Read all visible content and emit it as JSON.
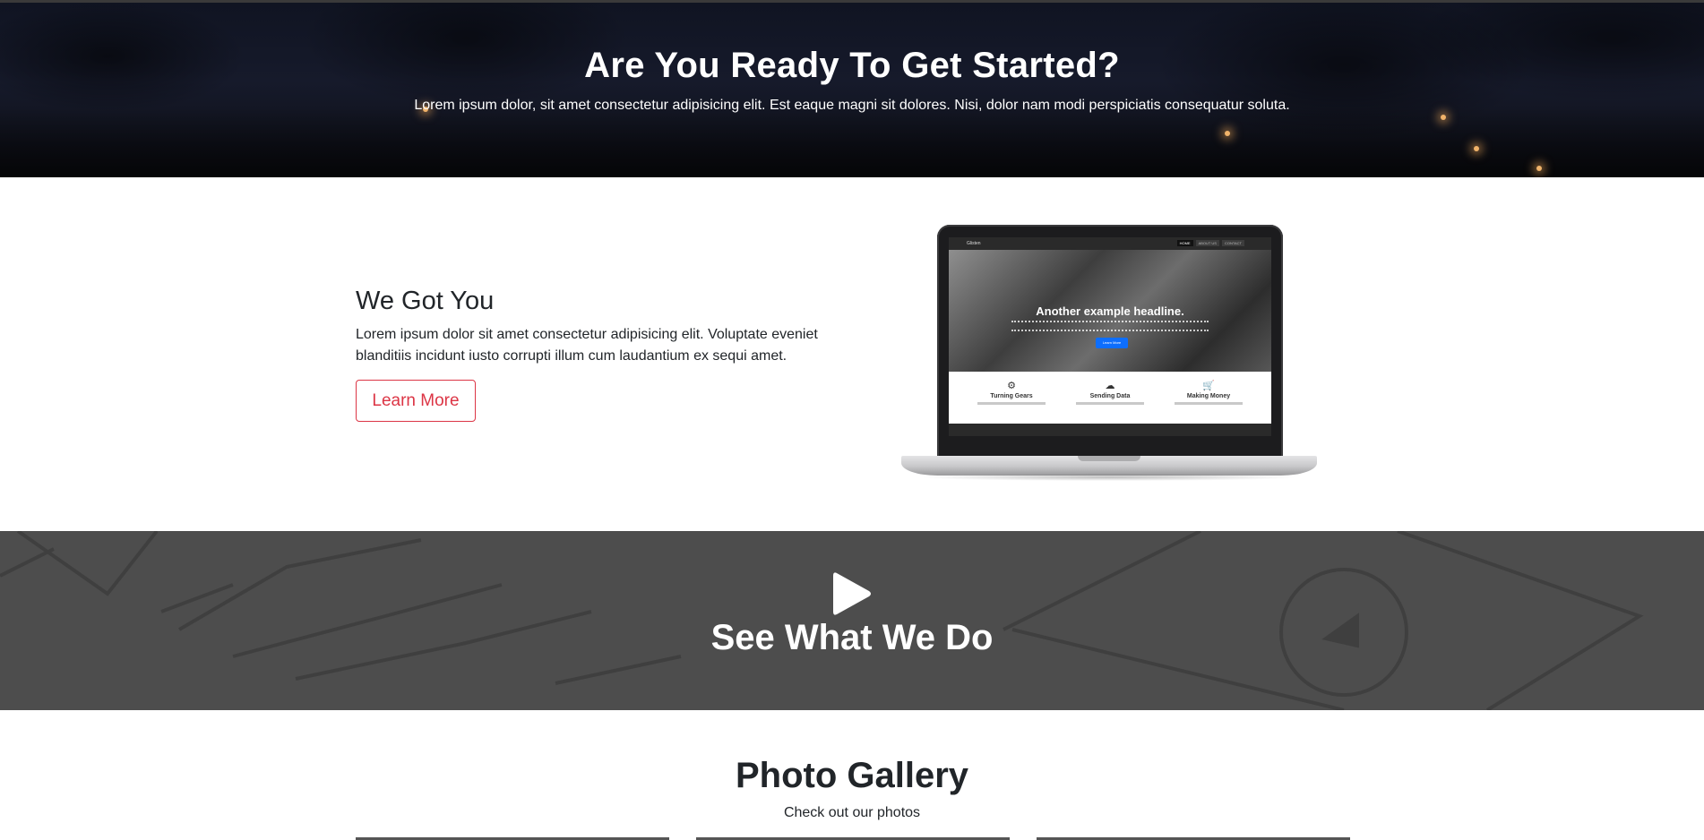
{
  "hero": {
    "title": "Are You Ready To Get Started?",
    "subtitle": "Lorem ipsum dolor, sit amet consectetur adipisicing elit. Est eaque magni sit dolores. Nisi, dolor nam modi perspiciatis consequatur soluta."
  },
  "about": {
    "title": "We Got You",
    "description": "Lorem ipsum dolor sit amet consectetur adipisicing elit. Voluptate eveniet blanditiis incidunt iusto corrupti illum cum laudantium ex sequi amet.",
    "button_label": "Learn More",
    "laptop_screen": {
      "brand": "Glisten",
      "nav": [
        "HOME",
        "ABOUT US",
        "CONTACT"
      ],
      "headline": "Another example headline.",
      "button_label": "Learn More",
      "features": [
        {
          "icon": "gear-icon",
          "glyph": "⚙",
          "name": "Turning Gears"
        },
        {
          "icon": "cloud-icon",
          "glyph": "☁",
          "name": "Sending Data"
        },
        {
          "icon": "cart-icon",
          "glyph": "🛒",
          "name": "Making Money"
        }
      ]
    }
  },
  "video": {
    "title": "See What We Do",
    "play_icon": "play-icon"
  },
  "gallery": {
    "title": "Photo Gallery",
    "subtitle": "Check out our photos"
  },
  "colors": {
    "accent": "#dc3545",
    "hero_bg": "#12151f",
    "video_bg": "#4f4f4f",
    "text": "#212529"
  }
}
